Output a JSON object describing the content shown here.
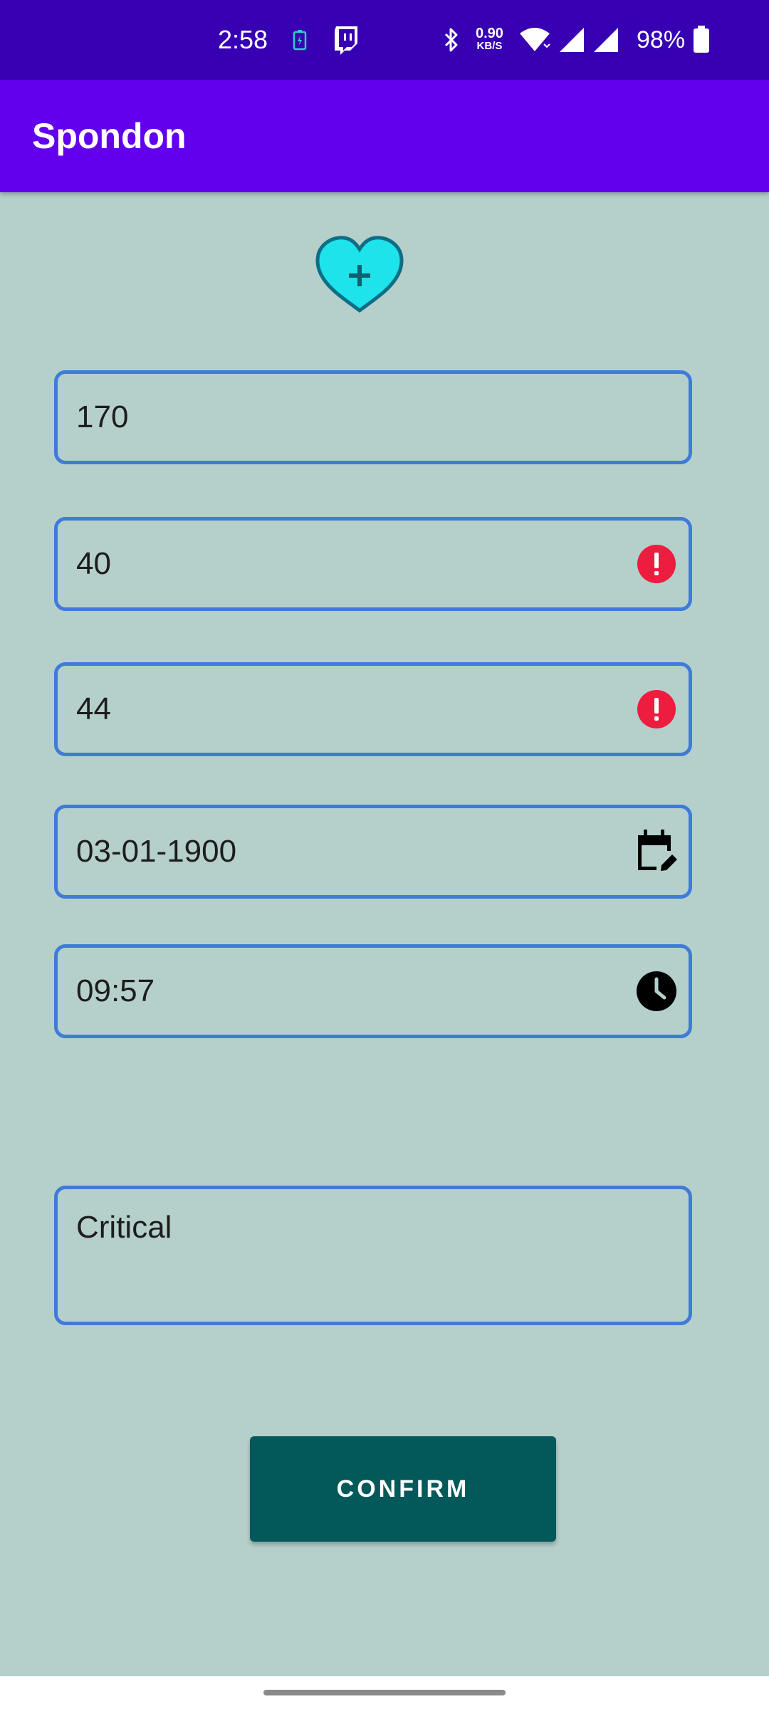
{
  "status_bar": {
    "time": "2:58",
    "speed_value": "0.90",
    "speed_unit": "KB/S",
    "battery_percent": "98%",
    "icons": [
      "battery-saver-icon",
      "twitch-icon",
      "bluetooth-icon",
      "wifi-icon",
      "signal-icon",
      "signal-icon",
      "battery-icon"
    ]
  },
  "app_bar": {
    "title": "Spondon"
  },
  "logo": {
    "icon": "heart-plus-icon",
    "color": "#1fe3ea"
  },
  "form": {
    "height_value": "170",
    "systolic_value": "40",
    "systolic_error_icon": "error-icon",
    "diastolic_value": "44",
    "diastolic_error_icon": "error-icon",
    "date_value": "03-01-1900",
    "date_icon": "calendar-edit-icon",
    "time_value": "09:57",
    "time_icon": "clock-icon",
    "status_value": "Critical"
  },
  "confirm_label": "CONFIRM",
  "colors": {
    "status_bar": "#3700b3",
    "app_bar": "#6200ee",
    "background": "#b5cfcb",
    "field_border": "#3f7bd8",
    "error": "#ee1c3e",
    "button": "#03585a"
  }
}
